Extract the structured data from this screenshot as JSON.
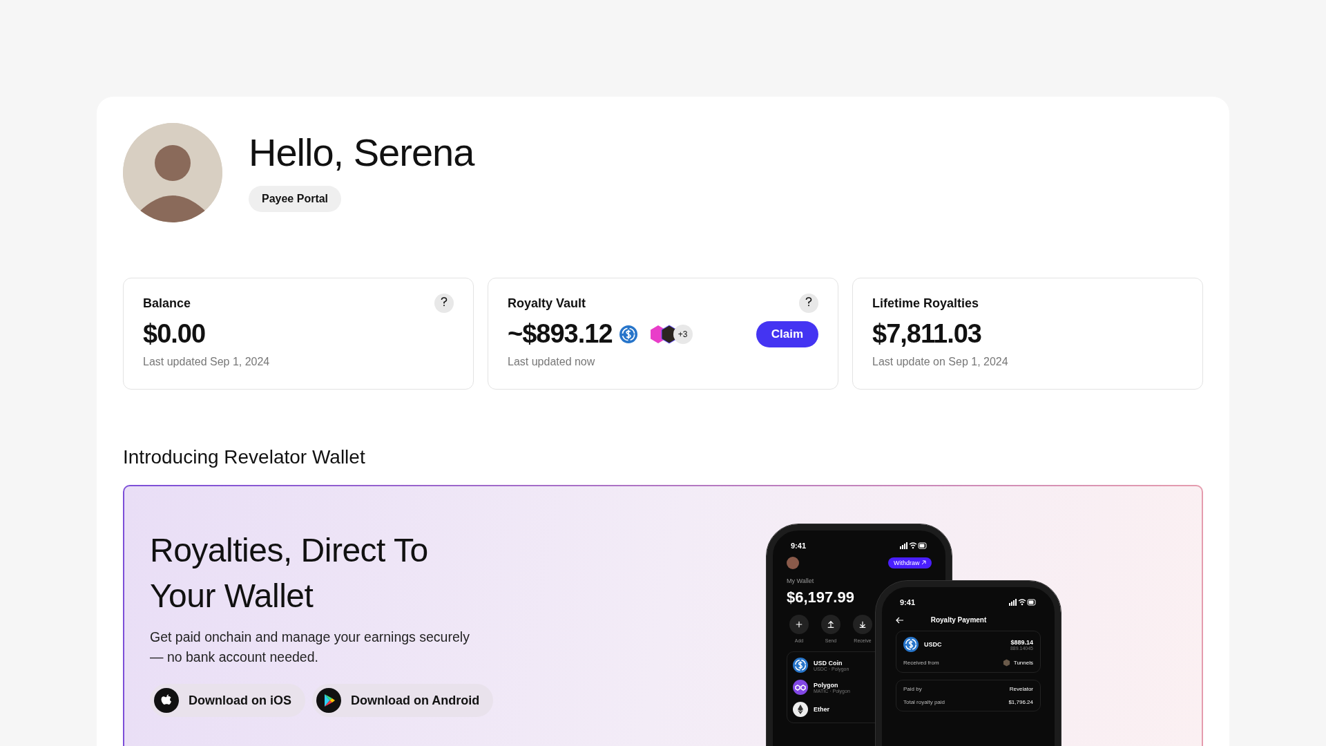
{
  "header": {
    "greeting": "Hello, Serena",
    "badge": "Payee Portal"
  },
  "stats": [
    {
      "kind": "plain",
      "help": true,
      "title": "Balance",
      "value": "$0.00",
      "note": "Last updated Sep 1, 2024"
    },
    {
      "kind": "vault",
      "help": true,
      "title": "Royalty Vault",
      "value": "~$893.12",
      "extra_count": "+3",
      "action": "Claim",
      "note": "Last updated now"
    },
    {
      "kind": "plain",
      "help": false,
      "title": "Lifetime Royalties",
      "value": "$7,811.03",
      "note": "Last update on Sep 1, 2024"
    }
  ],
  "promo": {
    "section_title": "Introducing Revelator Wallet",
    "headline": "Royalties, Direct To Your Wallet",
    "body": "Get paid onchain and manage your earnings securely — no bank account needed.",
    "buttons": [
      {
        "kind": "ios",
        "label": "Download on iOS"
      },
      {
        "kind": "android",
        "label": "Download on Android"
      }
    ],
    "phones": {
      "wallet": {
        "time": "9:41",
        "action": "Withdraw",
        "label": "My Wallet",
        "balance": "$6,197.99",
        "actions": [
          "Add",
          "Send",
          "Receive"
        ],
        "assets": [
          {
            "kind": "usdc",
            "name": "USD Coin",
            "network": "USDC · Polygon"
          },
          {
            "kind": "polygon",
            "name": "Polygon",
            "network": "MATIC · Polygon"
          },
          {
            "kind": "ether",
            "name": "Ether"
          }
        ]
      },
      "payment": {
        "time": "9:41",
        "title": "Royalty Payment",
        "token": "USDC",
        "amount": "$889.14",
        "amount_sub": "889.14045",
        "from_label": "Received from",
        "from": "Tunnels",
        "rows": [
          {
            "label": "Paid by",
            "value": "Revelator"
          },
          {
            "label": "Total royalty paid",
            "value": "$1,796.24"
          }
        ]
      }
    }
  }
}
